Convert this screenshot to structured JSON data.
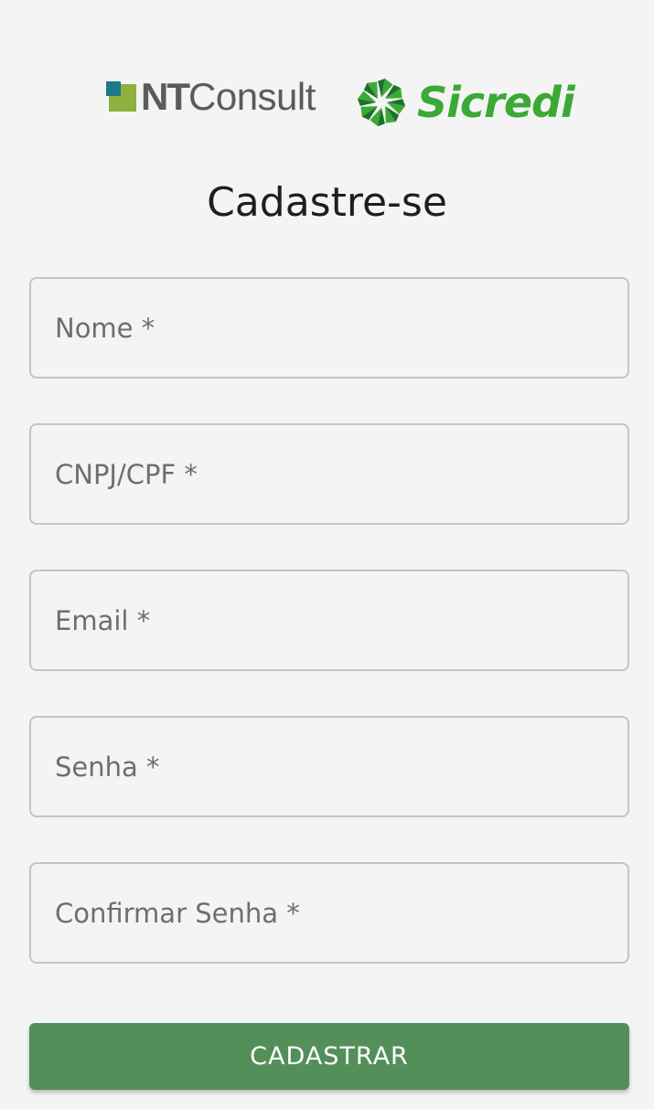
{
  "logos": {
    "ntconsult": {
      "bold_part": "NT",
      "light_part": "Consult",
      "colors": {
        "text": "#5b5b5b",
        "square_dark": "#1a7a86",
        "square_green": "#8db03e"
      }
    },
    "sicredi": {
      "text": "Sicredi",
      "icon": "sicredi-pinwheel-icon",
      "colors": {
        "primary": "#3aaa35",
        "dark": "#1e6f2b"
      }
    }
  },
  "form": {
    "title": "Cadastre-se",
    "fields": {
      "nome": {
        "placeholder": "Nome *",
        "value": ""
      },
      "cnpj_cpf": {
        "placeholder": "CNPJ/CPF *",
        "value": ""
      },
      "email": {
        "placeholder": "Email *",
        "value": ""
      },
      "senha": {
        "placeholder": "Senha *",
        "value": ""
      },
      "confirmar_senha": {
        "placeholder": "Confirmar Senha *",
        "value": ""
      }
    },
    "submit_label": "CADASTRAR",
    "colors": {
      "button": "#548f5a",
      "border": "#c4c4c4",
      "background": "#f4f4f4"
    }
  }
}
